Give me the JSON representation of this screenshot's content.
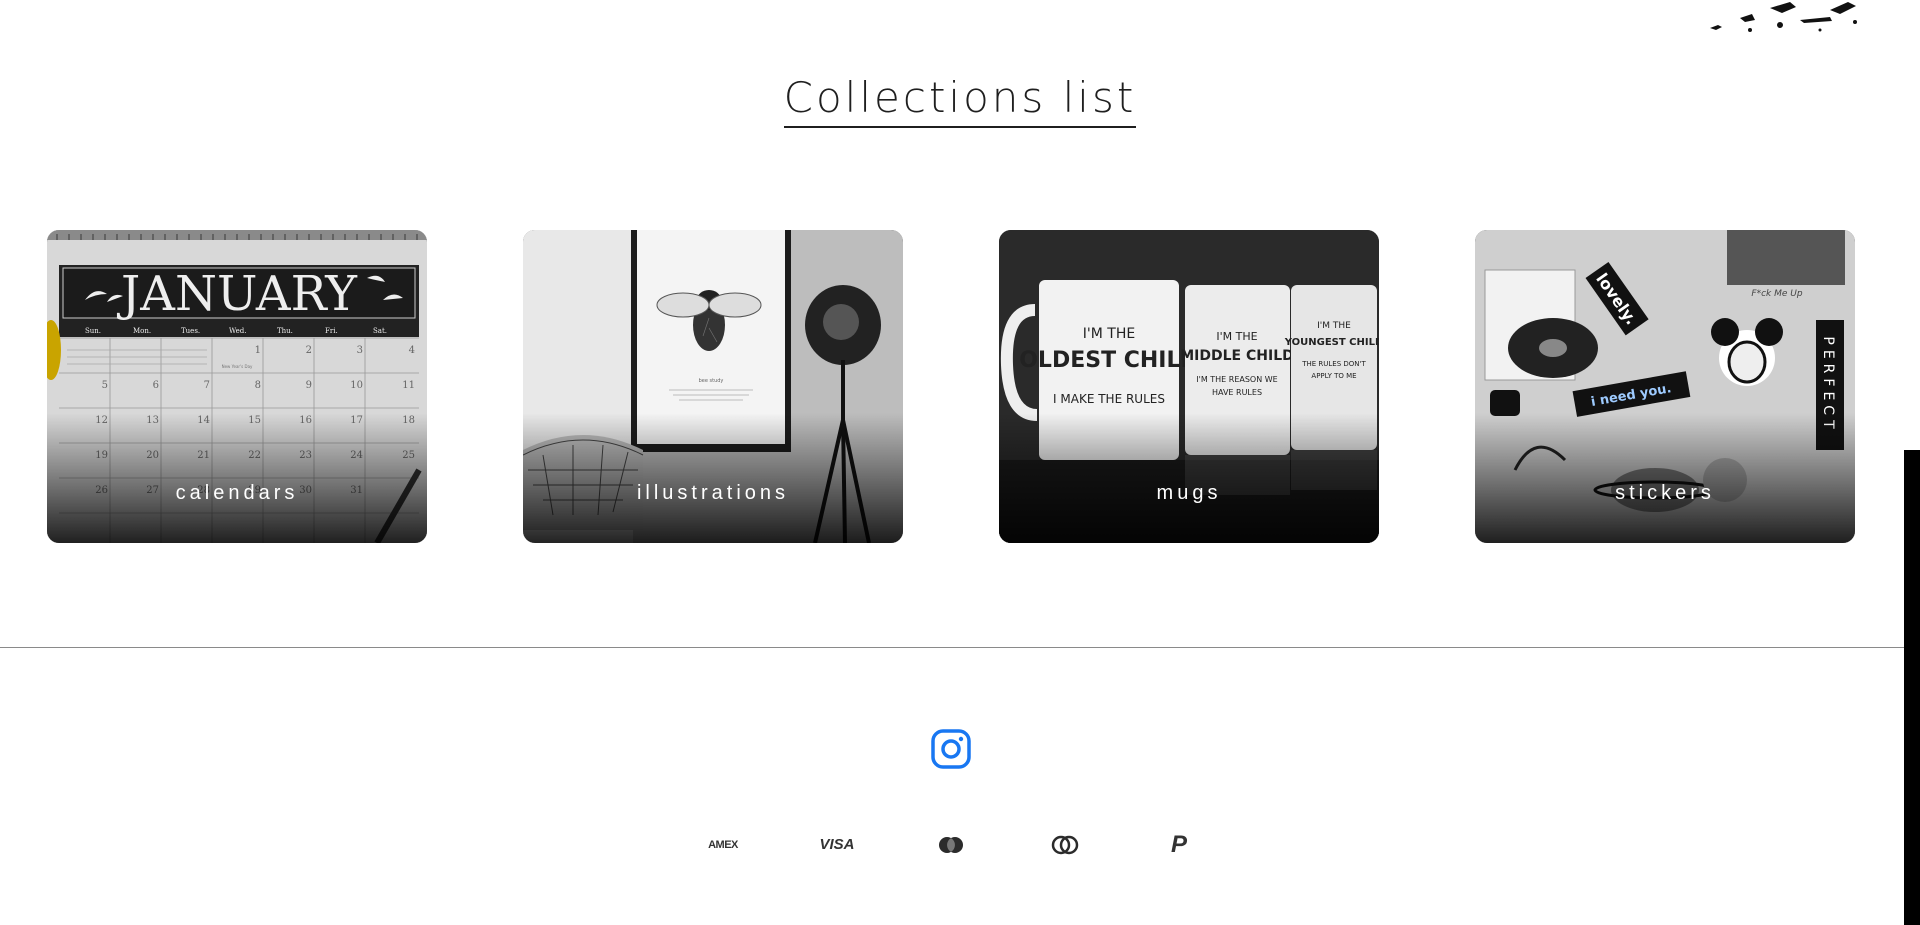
{
  "section": {
    "heading": "Collections list"
  },
  "collections": [
    {
      "label": "calendars"
    },
    {
      "label": "illustrations"
    },
    {
      "label": "mugs"
    },
    {
      "label": "stickers"
    }
  ],
  "card_images": {
    "calendar": {
      "month": "JANUARY",
      "weekdays": [
        "Sun.",
        "Mon.",
        "Tues.",
        "Wed.",
        "Thu.",
        "Fri.",
        "Sat."
      ],
      "numbers": [
        "1",
        "2",
        "3",
        "4",
        "5",
        "6",
        "7",
        "8",
        "9",
        "10",
        "11",
        "12",
        "13",
        "14",
        "15",
        "16",
        "17",
        "18",
        "19",
        "20",
        "21",
        "22",
        "23",
        "24",
        "25",
        "26",
        "27",
        "28",
        "29",
        "30",
        "31"
      ],
      "note": "New Year's Day"
    },
    "illustration": {
      "caption": "bee study"
    },
    "mugs": {
      "mug1": [
        "I'M THE",
        "OLDEST CHILD",
        "I MAKE THE RULES"
      ],
      "mug2": [
        "I'M THE",
        "MIDDLE CHILD",
        "I'M THE REASON WE",
        "HAVE RULES"
      ],
      "mug3": [
        "I'M THE",
        "YOUNGEST CHILD",
        "THE RULES DON'T",
        "APPLY TO ME"
      ]
    },
    "stickers": {
      "lovely": "lovely.",
      "perfect": "PERFECT",
      "need": "i need you.",
      "script": "F*ck Me Up"
    }
  },
  "footer": {
    "social_icon": "instagram-icon",
    "social_color": "#1877f2",
    "payment_methods": [
      {
        "name": "amex-icon",
        "text": "AMEX"
      },
      {
        "name": "visa-icon",
        "text": "VISA"
      },
      {
        "name": "mastercard-icon",
        "text": ""
      },
      {
        "name": "maestro-icon",
        "text": ""
      },
      {
        "name": "paypal-icon",
        "text": "P"
      }
    ]
  }
}
